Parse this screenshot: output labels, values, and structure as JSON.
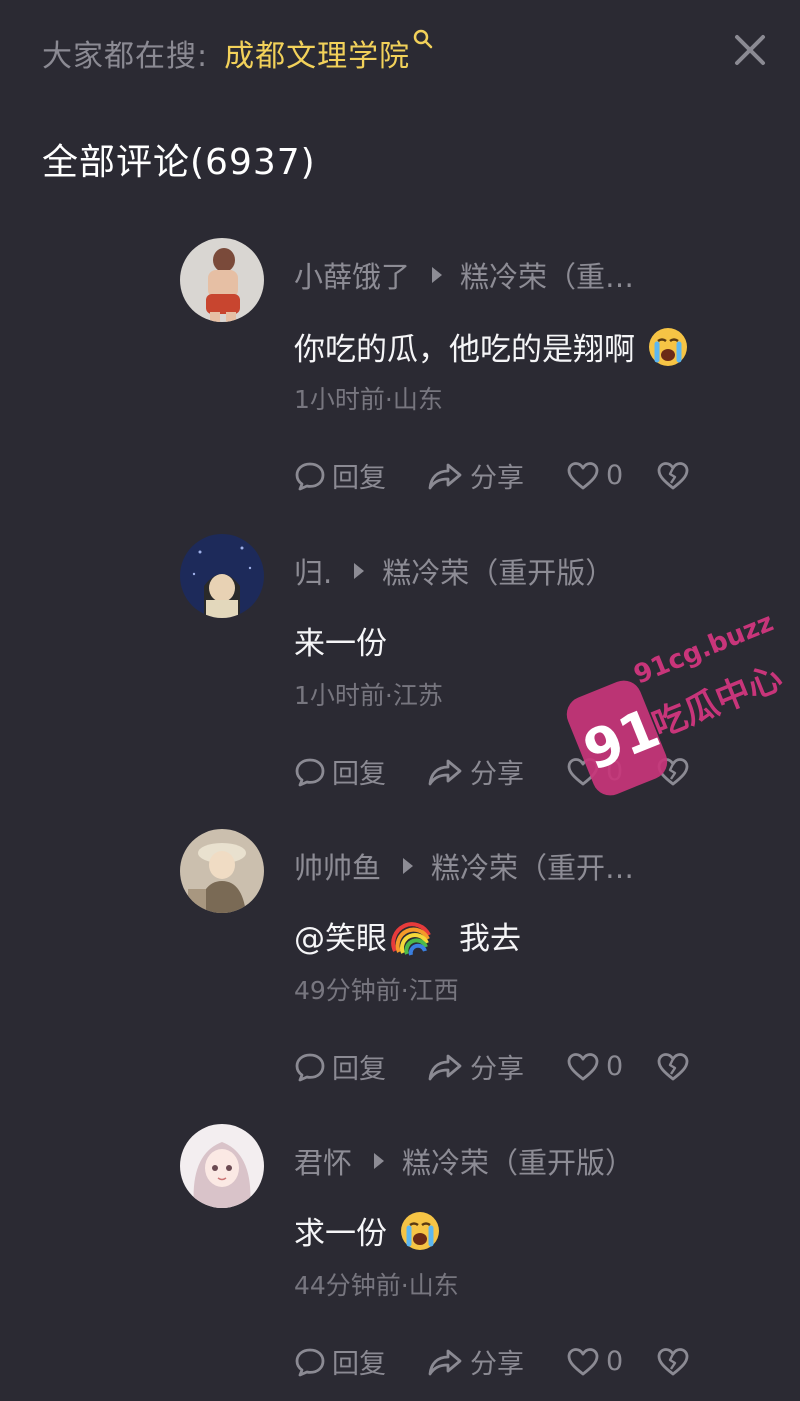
{
  "header": {
    "search_label": "大家都在搜:",
    "search_query": "成都文理学院",
    "title": "全部评论(6937)"
  },
  "comments": [
    {
      "author": "小薛饿了",
      "reply_to": "糕冷荣（重…",
      "text": "你吃的瓜，他吃的是翔啊",
      "emoji": "crying-face",
      "time_location": "1小时前·山东",
      "reply_label": "回复",
      "share_label": "分享",
      "like_count": "0"
    },
    {
      "author": "归.",
      "reply_to": "糕冷荣（重开版）",
      "text": "来一份",
      "emoji": "",
      "time_location": "1小时前·江苏",
      "reply_label": "回复",
      "share_label": "分享",
      "like_count": "0"
    },
    {
      "author": "帅帅鱼",
      "reply_to": "糕冷荣（重开…",
      "text_mention": "@笑眼",
      "text": "我去",
      "emoji": "rainbow",
      "time_location": "49分钟前·江西",
      "reply_label": "回复",
      "share_label": "分享",
      "like_count": "0"
    },
    {
      "author": "君怀",
      "reply_to": "糕冷荣（重开版）",
      "text": "求一份",
      "emoji": "crying-face",
      "time_location": "44分钟前·山东",
      "reply_label": "回复",
      "share_label": "分享",
      "like_count": "0"
    }
  ],
  "watermark": {
    "badge": "91",
    "domain": "91cg.buzz",
    "name": "吃瓜中心"
  },
  "colors": {
    "background": "#2b2a33",
    "accent_query": "#f2d15a",
    "muted_text": "#8d8c95",
    "watermark": "#c8357a"
  }
}
